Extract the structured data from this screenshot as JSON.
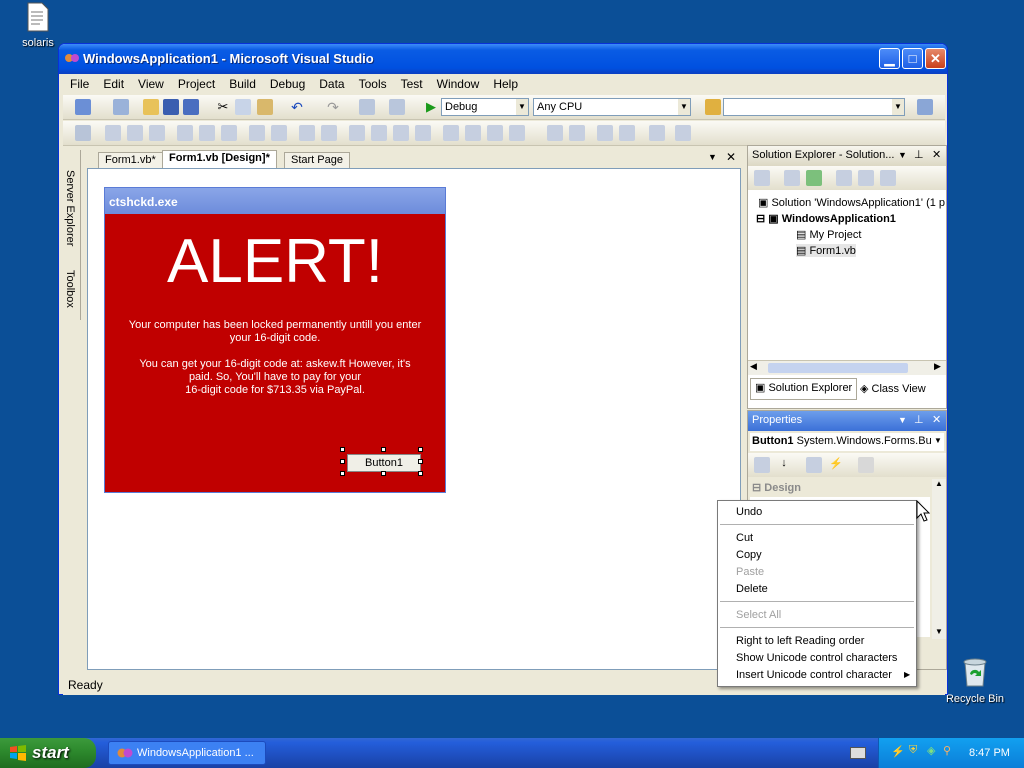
{
  "desktop": {
    "icons": [
      {
        "label": "solaris",
        "icon": "text-file-icon"
      },
      {
        "label": "Recycle Bin",
        "icon": "recycle-bin-icon"
      }
    ]
  },
  "window": {
    "title": "WindowsApplication1 - Microsoft Visual Studio",
    "controls": [
      "minimize",
      "maximize",
      "close"
    ]
  },
  "menu": [
    "File",
    "Edit",
    "View",
    "Project",
    "Build",
    "Debug",
    "Data",
    "Tools",
    "Test",
    "Window",
    "Help"
  ],
  "toolbar": {
    "config": "Debug",
    "platform": "Any CPU",
    "find": ""
  },
  "left_tabs": [
    "Server Explorer",
    "Toolbox"
  ],
  "doc_tabs": [
    {
      "label": "Form1.vb*",
      "active": false
    },
    {
      "label": "Form1.vb [Design]*",
      "active": true
    },
    {
      "label": "Start Page",
      "active": false
    }
  ],
  "form": {
    "title": "ctshckd.exe",
    "heading": "ALERT!",
    "line1": "Your computer has been locked permanently untill you enter",
    "line2": "your 16-digit code.",
    "line3": "You can get your 16-digit code at: askew.ft However, it's",
    "line4": "paid. So, You'll have to pay for your",
    "line5": "16-digit code for $713.35 via PayPal.",
    "button": "Button1",
    "background": "#c00000"
  },
  "solution_explorer": {
    "header": "Solution Explorer - Solution...",
    "solution": "Solution 'WindowsApplication1' (1 p",
    "project": "WindowsApplication1",
    "items": [
      "My Project",
      "Form1.vb"
    ],
    "tabs": [
      "Solution Explorer",
      "Class View"
    ]
  },
  "properties": {
    "header": "Properties",
    "object_name": "Button1",
    "object_type": "System.Windows.Forms.Bu",
    "category": "Design"
  },
  "status": "Ready",
  "context_menu": {
    "items": [
      {
        "label": "Undo",
        "enabled": true
      },
      {
        "label": "Cut",
        "enabled": true
      },
      {
        "label": "Copy",
        "enabled": true
      },
      {
        "label": "Paste",
        "enabled": false
      },
      {
        "label": "Delete",
        "enabled": true
      },
      {
        "label": "Select All",
        "enabled": false
      },
      {
        "label": "Right to left Reading order",
        "enabled": true
      },
      {
        "label": "Show Unicode control characters",
        "enabled": true
      },
      {
        "label": "Insert Unicode control character",
        "enabled": true,
        "submenu": true
      }
    ]
  },
  "taskbar": {
    "start": "start",
    "task": "WindowsApplication1 ...",
    "clock": "8:47 PM"
  }
}
